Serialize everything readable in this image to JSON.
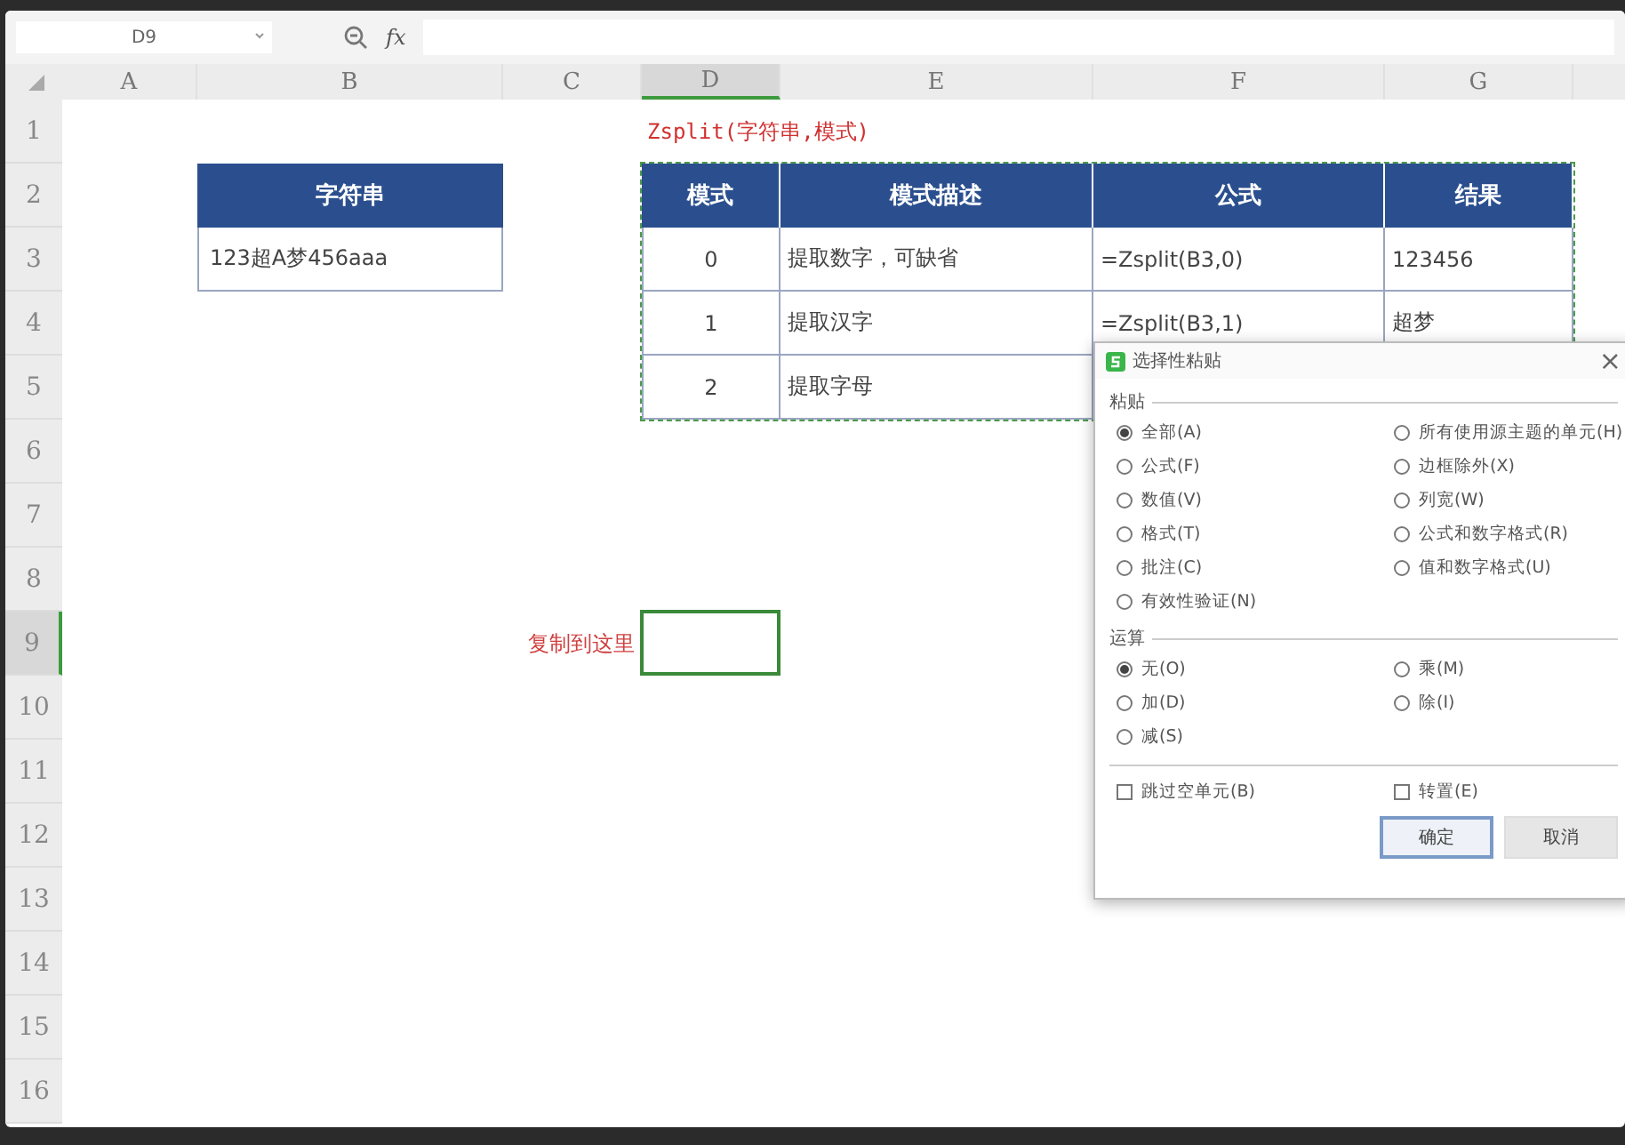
{
  "formula_bar": {
    "name_box": "D9",
    "fx": "fx"
  },
  "column_headers": [
    {
      "label": "A",
      "selected": false
    },
    {
      "label": "B",
      "selected": false
    },
    {
      "label": "C",
      "selected": false
    },
    {
      "label": "D",
      "selected": true
    },
    {
      "label": "E",
      "selected": false
    },
    {
      "label": "F",
      "selected": false
    },
    {
      "label": "G",
      "selected": false
    }
  ],
  "row_headers": [
    {
      "label": "1",
      "selected": false
    },
    {
      "label": "2",
      "selected": false
    },
    {
      "label": "3",
      "selected": false
    },
    {
      "label": "4",
      "selected": false
    },
    {
      "label": "5",
      "selected": false
    },
    {
      "label": "6",
      "selected": false
    },
    {
      "label": "7",
      "selected": false
    },
    {
      "label": "8",
      "selected": false
    },
    {
      "label": "9",
      "selected": true
    },
    {
      "label": "10",
      "selected": false
    },
    {
      "label": "11",
      "selected": false
    },
    {
      "label": "12",
      "selected": false
    },
    {
      "label": "13",
      "selected": false
    },
    {
      "label": "14",
      "selected": false
    },
    {
      "label": "15",
      "selected": false
    },
    {
      "label": "16",
      "selected": false
    }
  ],
  "formula_title": "Zsplit(字符串,模式)",
  "source_table": {
    "header": "字符串",
    "value": "123超A梦456aaa"
  },
  "mode_table": {
    "columns": [
      "模式",
      "模式描述",
      "公式",
      "结果"
    ],
    "rows": [
      [
        "0",
        "提取数字，可缺省",
        "=Zsplit(B3,0)",
        "123456"
      ],
      [
        "1",
        "提取汉字",
        "=Zsplit(B3,1)",
        "超梦"
      ],
      [
        "2",
        "提取字母"
      ]
    ]
  },
  "copy_note": "复制到这里",
  "dialog": {
    "title": "选择性粘贴",
    "close": "×",
    "paste_label": "粘贴",
    "paste_options": [
      {
        "label": "全部(A)",
        "selected": true
      },
      {
        "label": "所有使用源主题的单元(H)",
        "selected": false
      },
      {
        "label": "公式(F)",
        "selected": false
      },
      {
        "label": "边框除外(X)",
        "selected": false
      },
      {
        "label": "数值(V)",
        "selected": false
      },
      {
        "label": "列宽(W)",
        "selected": false
      },
      {
        "label": "格式(T)",
        "selected": false
      },
      {
        "label": "公式和数字格式(R)",
        "selected": false
      },
      {
        "label": "批注(C)",
        "selected": false
      },
      {
        "label": "值和数字格式(U)",
        "selected": false
      },
      {
        "label": "有效性验证(N)",
        "selected": false
      }
    ],
    "operation_label": "运算",
    "operation_options": [
      {
        "label": "无(O)",
        "selected": true
      },
      {
        "label": "乘(M)",
        "selected": false
      },
      {
        "label": "加(D)",
        "selected": false
      },
      {
        "label": "除(I)",
        "selected": false
      },
      {
        "label": "减(S)",
        "selected": false
      }
    ],
    "checkboxes": [
      {
        "label": "跳过空单元(B)",
        "checked": false
      },
      {
        "label": "转置(E)",
        "checked": false
      }
    ],
    "buttons": [
      {
        "label": "确定",
        "kind": "default"
      },
      {
        "label": "取消",
        "kind": "normal"
      }
    ]
  }
}
